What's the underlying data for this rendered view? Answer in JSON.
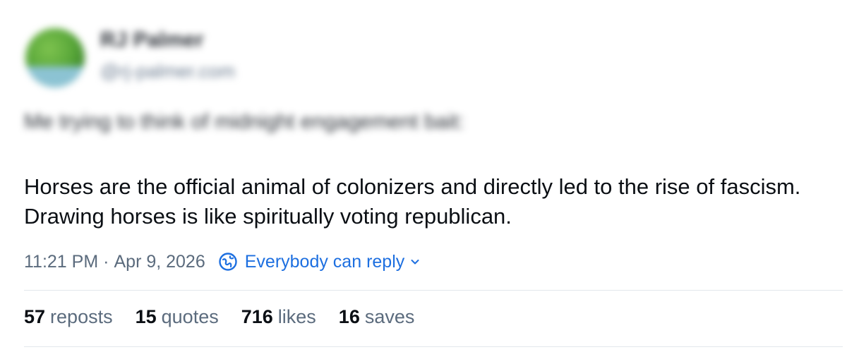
{
  "author": {
    "display_name": "RJ Palmer",
    "handle": "@rj-palmer.com"
  },
  "post": {
    "intro_line": "Me trying to think of midnight engagement bait:",
    "body": "Horses are the official animal of colonizers and directly led to the rise of fascism. Drawing horses is like spiritually voting republican."
  },
  "meta": {
    "time": "11:21 PM",
    "separator": "·",
    "date": "Apr 9, 2026",
    "reply_setting": "Everybody can reply",
    "reply_icon": "globe-icon",
    "chevron_icon": "chevron-down-icon"
  },
  "stats": [
    {
      "count": "57",
      "label": "reposts"
    },
    {
      "count": "15",
      "label": "quotes"
    },
    {
      "count": "716",
      "label": "likes"
    },
    {
      "count": "16",
      "label": "saves"
    }
  ],
  "colors": {
    "accent": "#1d6fe0",
    "muted": "#5b6b7d",
    "text": "#0b0f14",
    "divider": "#e3e7ec"
  }
}
